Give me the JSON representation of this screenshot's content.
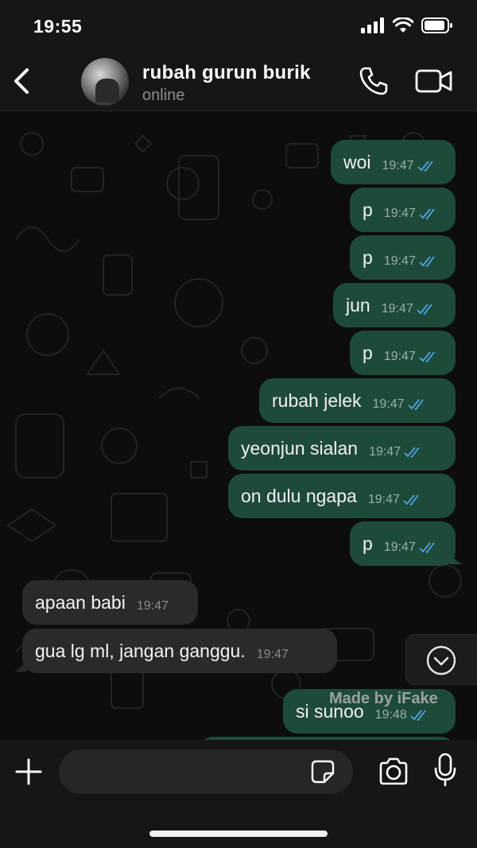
{
  "status_bar": {
    "time": "19:55"
  },
  "header": {
    "contact_name": "rubah gurun burik",
    "contact_status": "online"
  },
  "messages": [
    {
      "direction": "out",
      "text": "woi",
      "time": "19:47",
      "read": true
    },
    {
      "direction": "out",
      "text": "p",
      "time": "19:47",
      "read": true
    },
    {
      "direction": "out",
      "text": "p",
      "time": "19:47",
      "read": true
    },
    {
      "direction": "out",
      "text": "jun",
      "time": "19:47",
      "read": true
    },
    {
      "direction": "out",
      "text": "p",
      "time": "19:47",
      "read": true
    },
    {
      "direction": "out",
      "text": "rubah jelek",
      "time": "19:47",
      "read": true
    },
    {
      "direction": "out",
      "text": "yeonjun sialan",
      "time": "19:47",
      "read": true
    },
    {
      "direction": "out",
      "text": "on dulu ngapa",
      "time": "19:47",
      "read": true
    },
    {
      "direction": "out",
      "text": "p",
      "time": "19:47",
      "read": true
    },
    {
      "direction": "in",
      "text": "apaan babi",
      "time": "19:47"
    },
    {
      "direction": "in",
      "text": "gua lg ml, jangan ganggu.",
      "time": "19:47"
    },
    {
      "direction": "out",
      "text": "si sunoo",
      "time": "19:48",
      "read": true
    }
  ],
  "watermark": "Made by iFake",
  "input": {
    "placeholder": ""
  },
  "icons": {
    "back": "chevron-left-icon",
    "call": "phone-icon",
    "video": "video-camera-icon",
    "scroll_down": "chevron-down-circle-icon",
    "plus": "plus-icon",
    "sticker": "sticker-icon",
    "camera": "camera-icon",
    "mic": "microphone-icon"
  },
  "colors": {
    "outgoing_bubble": "#1e4a3a",
    "incoming_bubble": "#2a2a2a",
    "read_ticks": "#4fa3e0",
    "background": "#0d0d0d"
  }
}
